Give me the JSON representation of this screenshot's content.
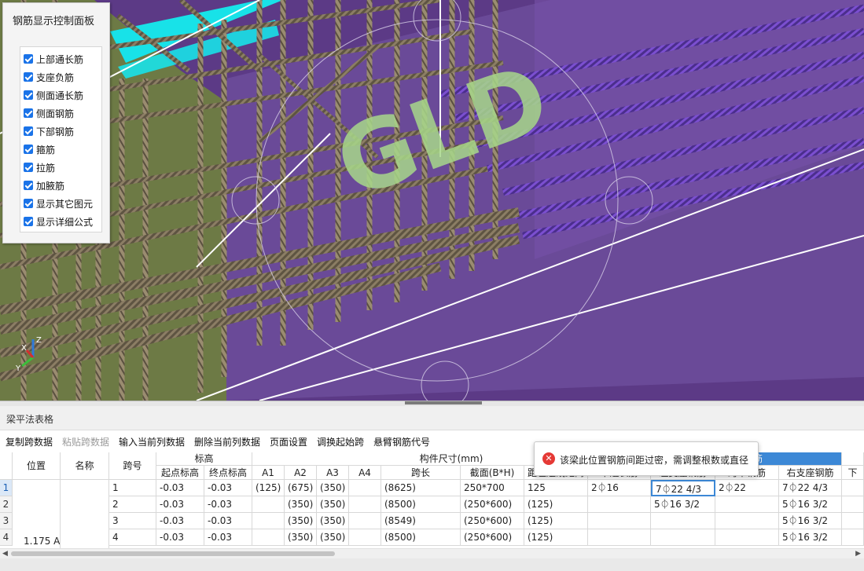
{
  "viewport": {
    "watermark": "GLD",
    "axis_labels": {
      "x": "X",
      "y": "Y",
      "z": "Z"
    },
    "colors": {
      "background": "#5c3a86",
      "beam_green": "#6e7a4a",
      "cyan_bar": "#17e6ea",
      "rebar": "#8a7a62",
      "purple_rebar": "#6a3fc2"
    }
  },
  "panel": {
    "title": "钢筋显示控制面板",
    "items": [
      {
        "label": "上部通长筋"
      },
      {
        "label": "支座负筋"
      },
      {
        "label": "侧面通长筋"
      },
      {
        "label": "侧面钢筋"
      },
      {
        "label": "下部钢筋"
      },
      {
        "label": "箍筋"
      },
      {
        "label": "拉筋"
      },
      {
        "label": "加腋筋"
      },
      {
        "label": "显示其它图元"
      },
      {
        "label": "显示详细公式"
      }
    ]
  },
  "table": {
    "title": "梁平法表格",
    "toolbar": {
      "copy": "复制跨数据",
      "paste": "粘贴跨数据",
      "input_col": "输入当前列数据",
      "delete_col": "删除当前列数据",
      "page_setup": "页面设置",
      "swap_start": "调换起始跨",
      "cantilever": "悬臂钢筋代号"
    },
    "headers": {
      "position": "位置",
      "name": "名称",
      "span": "跨号",
      "elevation_group": "标高",
      "elev_start": "起点标高",
      "elev_end": "终点标高",
      "dim_group": "构件尺寸(mm)",
      "a1": "A1",
      "a2": "A2",
      "a3": "A3",
      "a4": "A4",
      "span_len": "跨长",
      "section": "截面(B*H)",
      "col_h": "距左边线距离",
      "rebar_group": "筋",
      "col_i": "下通长筋",
      "col_j": "左支座钢筋",
      "col_k": "跨中钢筋",
      "right_support": "右支座钢筋",
      "col_m": "下"
    },
    "rows": [
      {
        "n": "1",
        "span": "1",
        "e1": "-0.03",
        "e2": "-0.03",
        "a1": "(125)",
        "a2": "(675)",
        "a3": "(350)",
        "a4": "",
        "len": "(8625)",
        "sec": "250*700",
        "h": "125",
        "i": "2⏀16",
        "j": "7⏀22 4/3",
        "k": "2⏀22",
        "l": "7⏀22 4/3"
      },
      {
        "n": "2",
        "span": "2",
        "e1": "-0.03",
        "e2": "-0.03",
        "a1": "",
        "a2": "(350)",
        "a3": "(350)",
        "a4": "",
        "len": "(8500)",
        "sec": "(250*600)",
        "h": "(125)",
        "i": "",
        "j": "5⏀16 3/2",
        "k": "",
        "l": "5⏀16 3/2"
      },
      {
        "n": "3",
        "span": "3",
        "e1": "-0.03",
        "e2": "-0.03",
        "a1": "",
        "a2": "(350)",
        "a3": "(350)",
        "a4": "",
        "len": "(8549)",
        "sec": "(250*600)",
        "h": "(125)",
        "i": "",
        "j": "",
        "k": "",
        "l": "5⏀16 3/2"
      },
      {
        "n": "4",
        "span": "4",
        "e1": "-0.03",
        "e2": "-0.03",
        "a1": "",
        "a2": "(350)",
        "a3": "(350)",
        "a4": "",
        "len": "(8500)",
        "sec": "(250*600)",
        "h": "(125)",
        "i": "",
        "j": "",
        "k": "",
        "l": "5⏀16 3/2"
      }
    ],
    "position_cut": "1.175 A"
  },
  "tooltip": {
    "message": "该梁此位置钢筋间距过密，需调整根数或直径"
  }
}
